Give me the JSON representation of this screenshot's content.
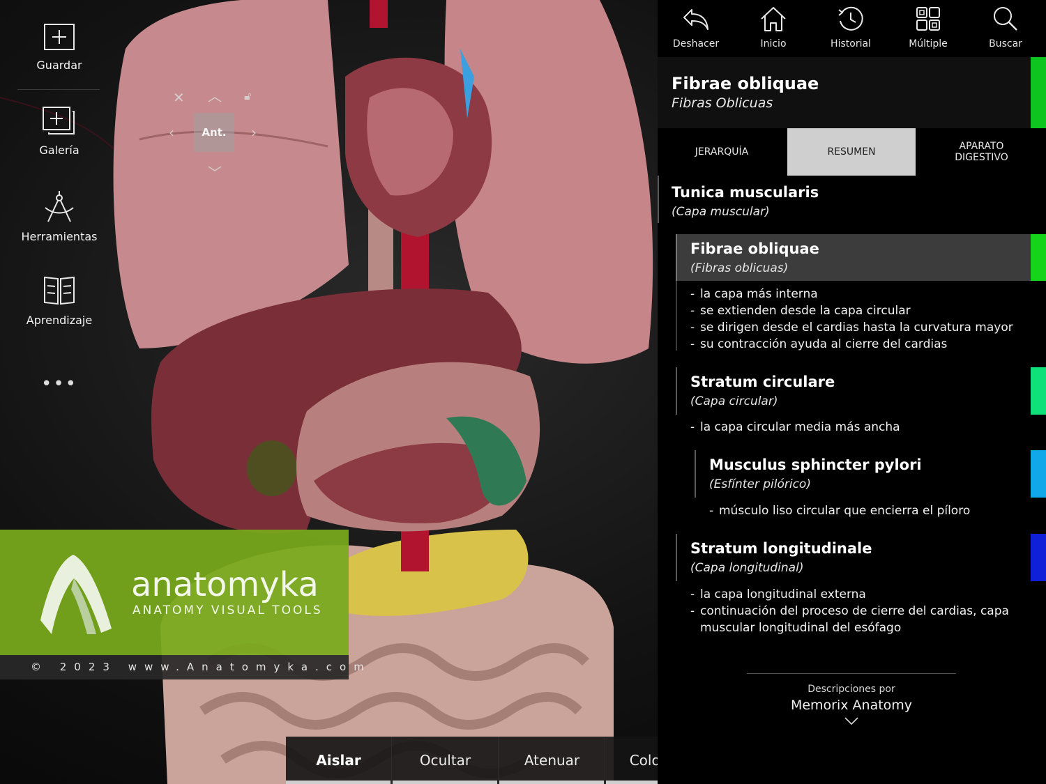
{
  "sidebar": {
    "items": [
      {
        "label": "Guardar",
        "icon": "save-plus-icon"
      },
      {
        "label": "Galería",
        "icon": "gallery-icon"
      },
      {
        "label": "Herramientas",
        "icon": "tools-compass-icon"
      },
      {
        "label": "Aprendizaje",
        "icon": "book-icon"
      }
    ],
    "more_label": "•••"
  },
  "orientation": {
    "view_label": "Ant."
  },
  "toolbar": {
    "items": [
      {
        "label": "Deshacer",
        "icon": "undo-icon"
      },
      {
        "label": "Inicio",
        "icon": "home-icon"
      },
      {
        "label": "Historial",
        "icon": "history-clock-icon"
      },
      {
        "label": "Múltiple",
        "icon": "multiple-grid-icon"
      },
      {
        "label": "Buscar",
        "icon": "search-icon"
      }
    ]
  },
  "selection": {
    "title": "Fibrae obliquae",
    "subtitle": "Fibras Oblicuas",
    "color": "#0ec41e"
  },
  "tabs": [
    {
      "label": "JERARQUÍA",
      "active": false
    },
    {
      "label": "RESUMEN",
      "active": true
    },
    {
      "label": "APARATO\nDIGESTIVO",
      "active": false
    }
  ],
  "summary": {
    "parent": {
      "title": "Tunica muscularis",
      "subtitle": "(Capa muscular)"
    },
    "items": [
      {
        "title": "Fibrae obliquae",
        "subtitle": "(Fibras oblicuas)",
        "color": "#16d41a",
        "selected": true,
        "bullets": [
          "la capa más interna",
          "se extienden desde la capa circular",
          "se dirigen desde el cardias hasta la curvatura mayor",
          "su contracción ayuda al cierre del cardias"
        ]
      },
      {
        "title": "Stratum circulare",
        "subtitle": "(Capa circular)",
        "color": "#0fe07a",
        "bullets": [
          "la capa circular media más ancha"
        ]
      },
      {
        "title": "Musculus sphincter pylori",
        "subtitle": "(Esfínter pilórico)",
        "color": "#10a8e8",
        "bullets": [
          "músculo liso circular que encierra el píloro"
        ]
      },
      {
        "title": "Stratum longitudinale",
        "subtitle": "(Capa longitudinal)",
        "color": "#1020d8",
        "bullets": [
          "la capa longitudinal externa",
          "continuación del proceso de cierre del cardias, capa muscular longitudinal del esófago"
        ]
      }
    ],
    "credits": {
      "line1": "Descripciones por",
      "line2": "Memorix Anatomy"
    }
  },
  "actions": [
    {
      "label": "Aislar",
      "bold": true
    },
    {
      "label": "Ocultar",
      "bold": false
    },
    {
      "label": "Atenuar",
      "bold": false
    },
    {
      "label": "Colorear",
      "bold": false
    }
  ],
  "watermark": {
    "brand": "anatomyka",
    "tagline": "ANATOMY VISUAL TOOLS",
    "copyright": "© 2023 www.Anatomyka.com"
  }
}
